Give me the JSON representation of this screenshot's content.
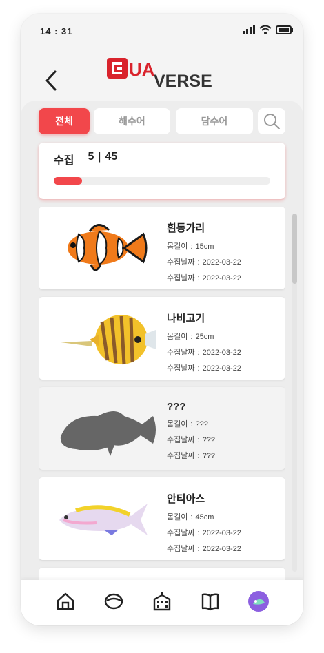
{
  "status_bar": {
    "time": "14 : 31",
    "icons": [
      "signal-icon",
      "wifi-icon",
      "battery-icon"
    ]
  },
  "header": {
    "logo_text_left": "UA",
    "logo_text_right": "VERSE",
    "back_icon": "chevron-left-icon"
  },
  "tabs": [
    {
      "label": "전체",
      "active": true
    },
    {
      "label": "해수어",
      "active": false
    },
    {
      "label": "담수어",
      "active": false
    }
  ],
  "search_icon": "search-icon",
  "collection": {
    "label": "수집",
    "count": "5",
    "separator": "|",
    "total": "45",
    "progress": 0.13
  },
  "fish": [
    {
      "name": "흰동가리",
      "length_label": "몸길이",
      "length": "15cm",
      "date_label": "수집날짜",
      "date": "2022-03-22",
      "date_label_2": "수집날짜",
      "date_2": "2022-03-22",
      "known": true
    },
    {
      "name": "나비고기",
      "length_label": "몸길이",
      "length": "25cm",
      "date_label": "수집날짜",
      "date": "2022-03-22",
      "date_label_2": "수집날짜",
      "date_2": "2022-03-22",
      "known": true
    },
    {
      "name": "???",
      "length_label": "몸길이",
      "length": "???",
      "date_label": "수집날짜",
      "date": "???",
      "date_label_2": "수집날짜",
      "date_2": "???",
      "known": false
    },
    {
      "name": "안티아스",
      "length_label": "몸길이",
      "length": "45cm",
      "date_label": "수집날짜",
      "date": "2022-03-22",
      "date_label_2": "수집날짜",
      "date_2": "2022-03-22",
      "known": true
    }
  ],
  "nav": [
    "home-icon",
    "bowl-icon",
    "shop-icon",
    "book-icon",
    "profile-icon"
  ],
  "colors": {
    "accent": "#f2474b",
    "background": "#ededed",
    "card": "#ffffff",
    "silhouette": "#666666"
  }
}
